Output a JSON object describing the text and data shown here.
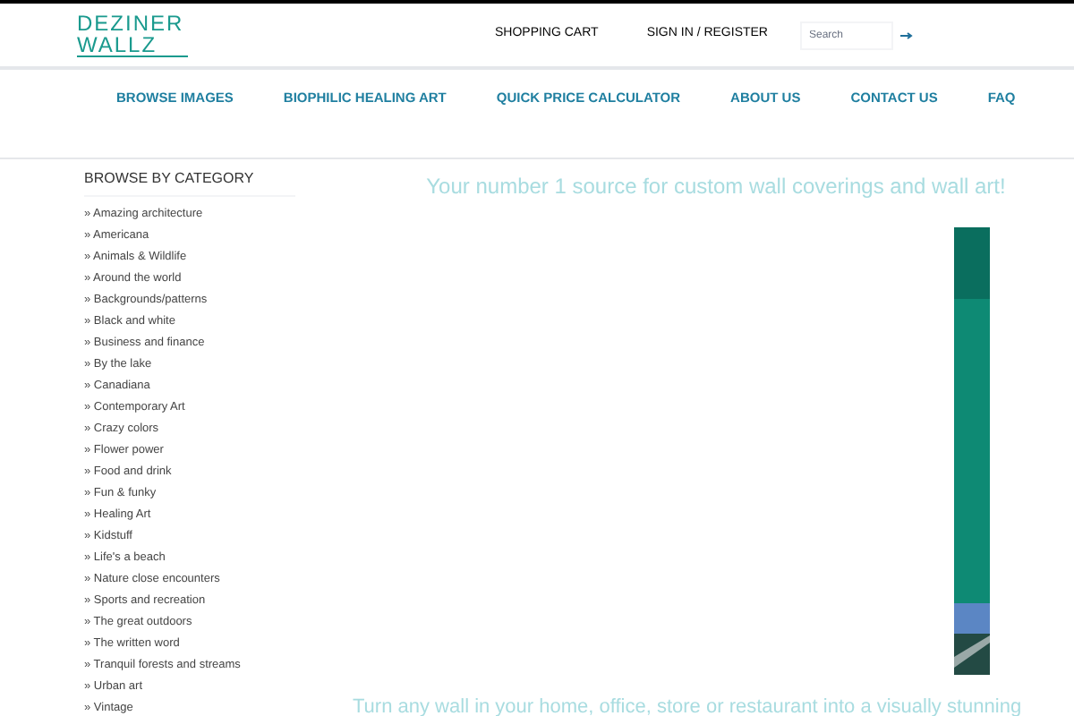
{
  "logo": {
    "line1": "DEZINER",
    "line2": "WALLZ"
  },
  "top_links": [
    "SHOPPING CART",
    "SIGN IN / REGISTER"
  ],
  "search": {
    "placeholder": "Search"
  },
  "nav": [
    "BROWSE IMAGES",
    "BIOPHILIC HEALING ART",
    "QUICK PRICE CALCULATOR",
    "ABOUT US",
    "CONTACT US",
    "FAQ"
  ],
  "sidebar": {
    "title": "BROWSE BY CATEGORY",
    "items": [
      "» Amazing architecture",
      "» Americana",
      "» Animals & Wildlife",
      "» Around the world",
      "» Backgrounds/patterns",
      "» Black and white",
      "» Business and finance",
      "» By the lake",
      "» Canadiana",
      "» Contemporary Art",
      "» Crazy colors",
      "» Flower power",
      "» Food and drink",
      "» Fun & funky",
      "» Healing Art",
      "» Kidstuff",
      "» Life's a beach",
      "» Nature close encounters",
      "» Sports and recreation",
      "» The great outdoors",
      "» The written word",
      "» Tranquil forests and streams",
      "» Urban art",
      "» Vintage"
    ]
  },
  "main": {
    "headline": "Your number 1 source for custom wall coverings and wall art!",
    "tagline": "Turn any wall in your home, office, store or restaurant into a visually stunning"
  }
}
